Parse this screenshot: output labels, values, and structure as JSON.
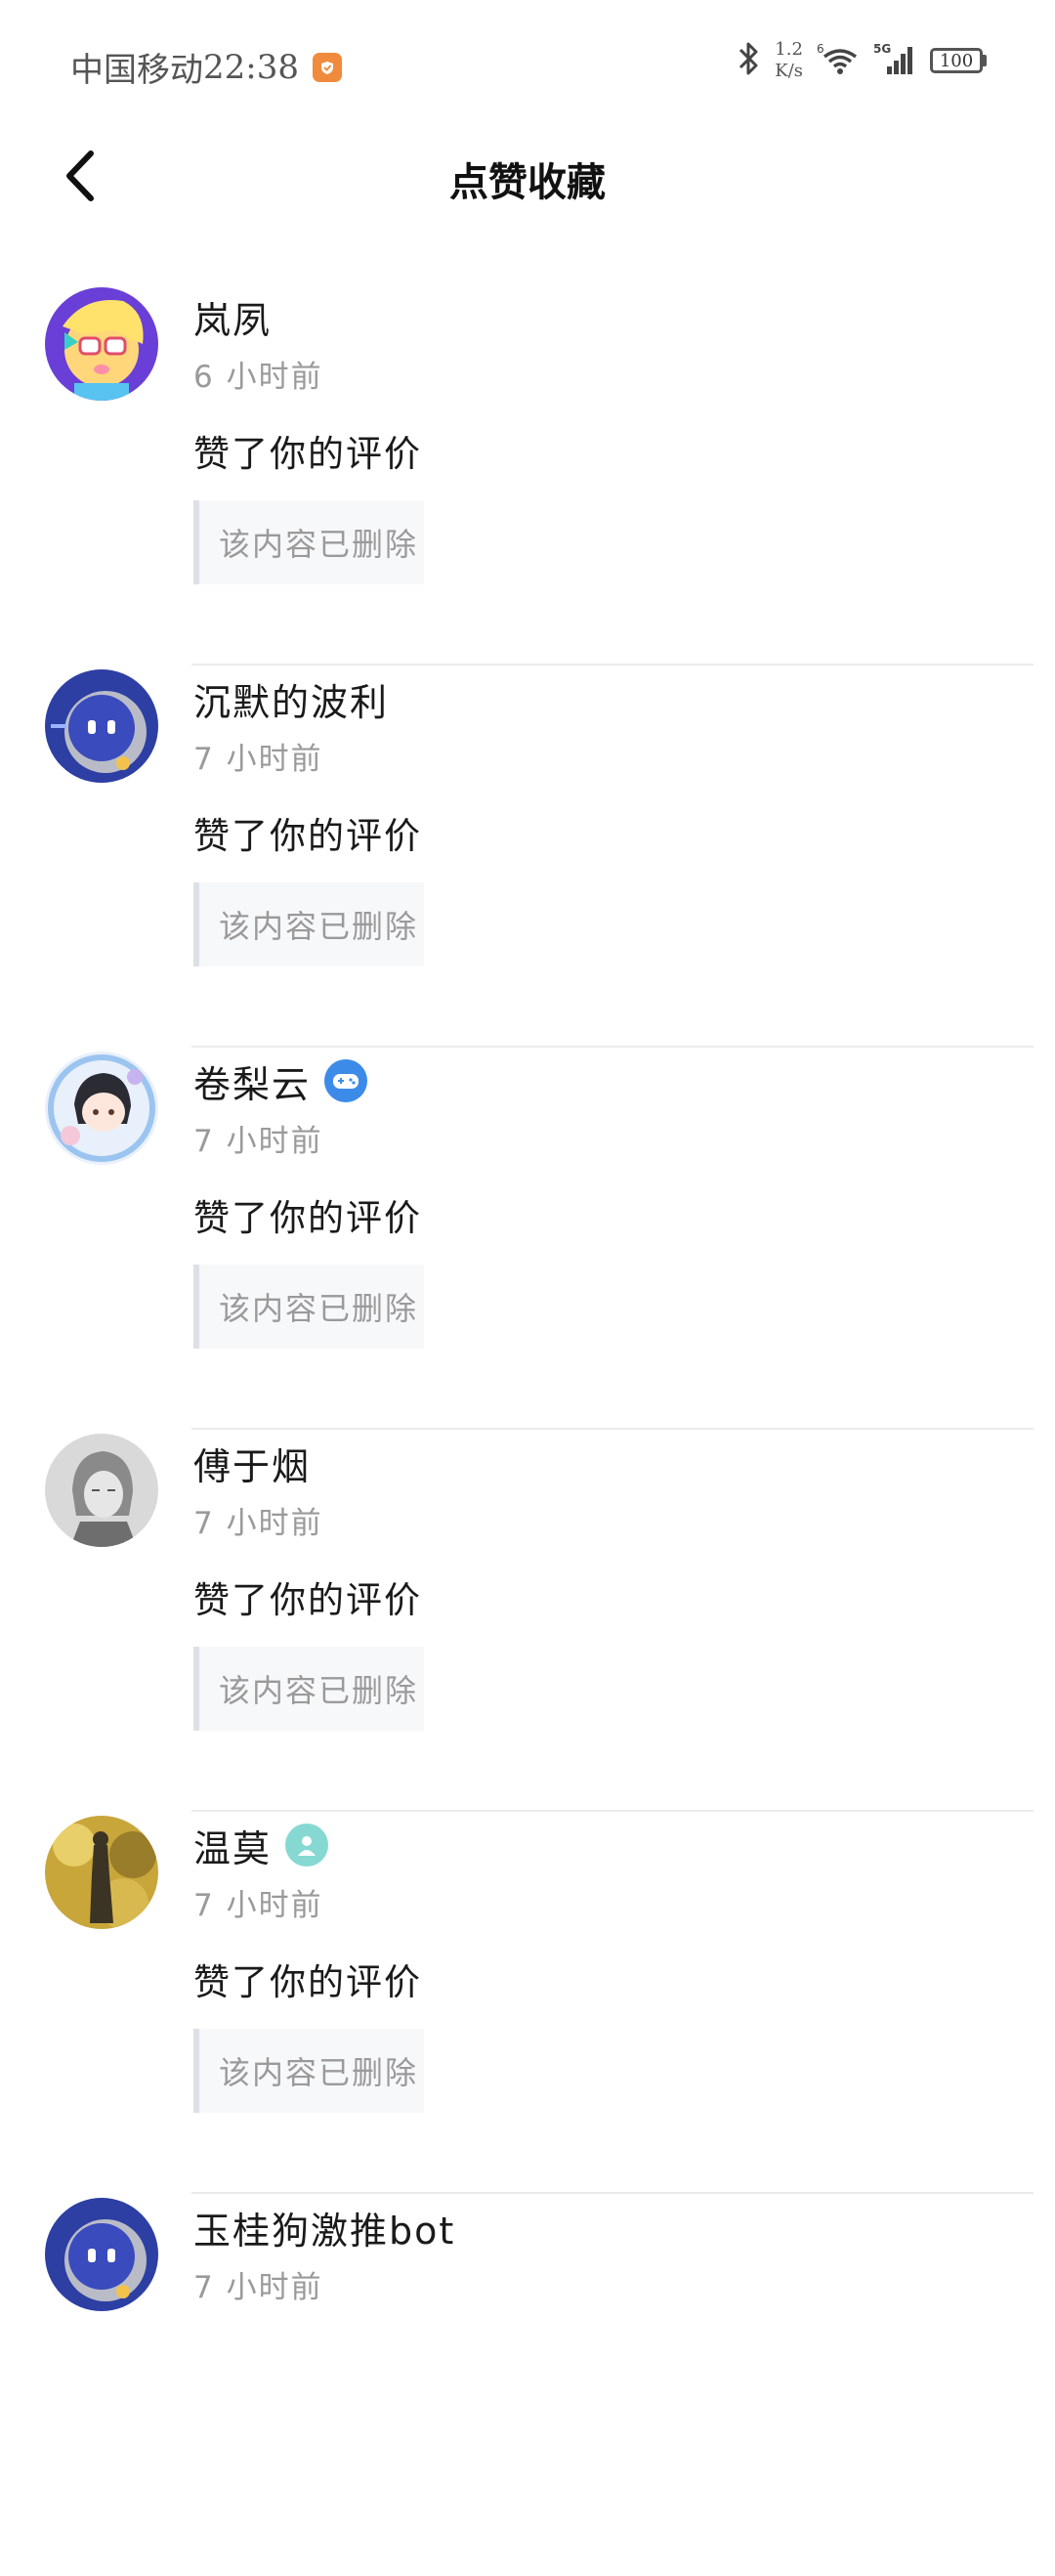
{
  "status_bar": {
    "carrier": "中国移动",
    "time": "22:38",
    "net_speed_value": "1.2",
    "net_speed_unit": "K/s",
    "battery": "100"
  },
  "header": {
    "title": "点赞收藏"
  },
  "items": [
    {
      "name": "岚夙",
      "time": "6 小时前",
      "action": "赞了你的评价",
      "quote": "该内容已删除"
    },
    {
      "name": "沉默的波利",
      "time": "7 小时前",
      "action": "赞了你的评价",
      "quote": "该内容已删除"
    },
    {
      "name": "卷梨云",
      "time": "7 小时前",
      "action": "赞了你的评价",
      "quote": "该内容已删除"
    },
    {
      "name": "傅于烟",
      "time": "7 小时前",
      "action": "赞了你的评价",
      "quote": "该内容已删除"
    },
    {
      "name": "温莫",
      "time": "7 小时前",
      "action": "赞了你的评价",
      "quote": "该内容已删除"
    },
    {
      "name": "玉桂狗激推bot",
      "time": "7 小时前"
    }
  ],
  "colors": {
    "accent_badge_blue": "#3d8be8",
    "accent_badge_teal": "#86d9d2",
    "robot_avatar_blue": "#2d3fa3"
  }
}
